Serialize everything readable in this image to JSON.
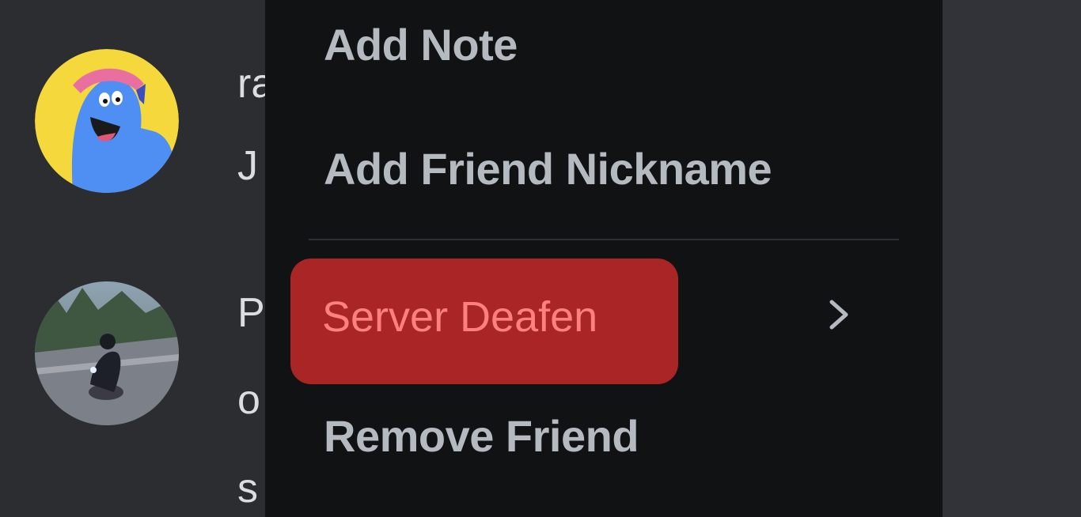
{
  "members": [
    {
      "name_fragment": "ra",
      "status_fragment": "J"
    },
    {
      "name_fragment": "P",
      "status_fragment": "o",
      "extra_fragment": "s"
    }
  ],
  "context_menu": {
    "items": [
      {
        "label": "Add Note"
      },
      {
        "label": "Add Friend Nickname"
      },
      {
        "label": "Server Deafen",
        "highlighted": true,
        "has_submenu": true
      },
      {
        "label": "Remove Friend"
      }
    ],
    "submenu_icon": "chevron-right-icon"
  },
  "colors": {
    "background": "#2b2d31",
    "menu_background": "#111214",
    "highlight": "#aa2626",
    "highlight_text": "#ff8080",
    "menu_text": "#b5bac1"
  }
}
